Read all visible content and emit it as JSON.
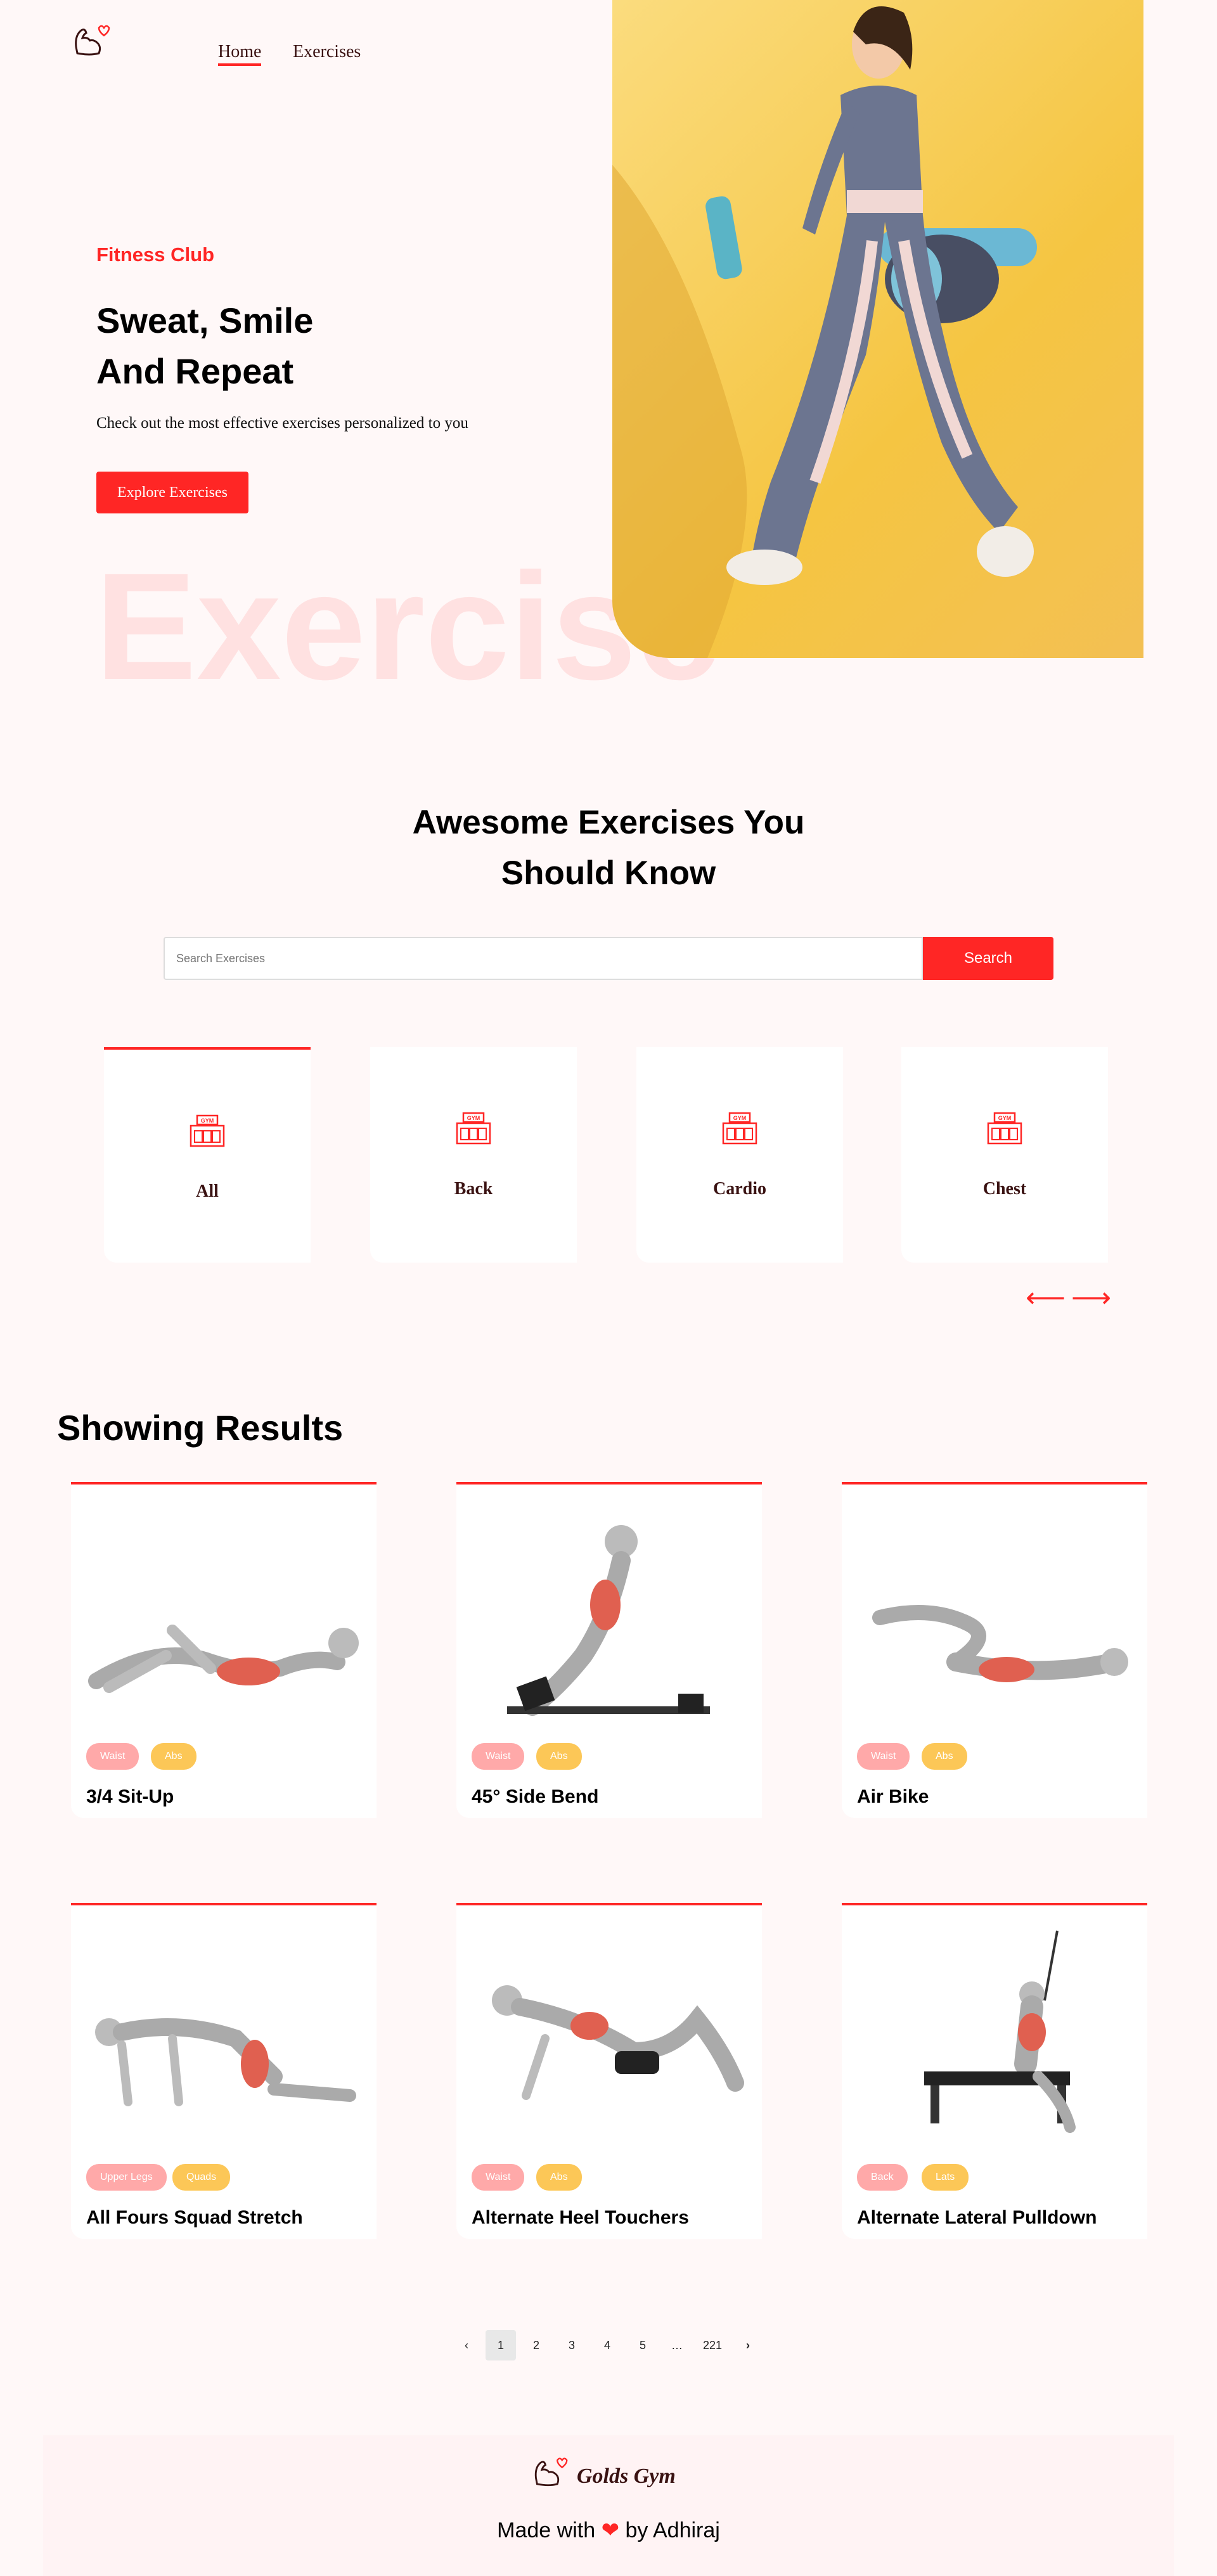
{
  "navbar": {
    "home": "Home",
    "exercises": "Exercises"
  },
  "hero": {
    "tag": "Fitness Club",
    "title_line1": "Sweat, Smile",
    "title_line2": "And Repeat",
    "description": "Check out the most effective exercises personalized to you",
    "button": "Explore Exercises",
    "bg_word": "Exercise"
  },
  "search": {
    "title_line1": "Awesome Exercises You",
    "title_line2": "Should Know",
    "placeholder": "Search Exercises",
    "button": "Search"
  },
  "body_parts": [
    {
      "label": "All",
      "icon": "gym-icon"
    },
    {
      "label": "Back",
      "icon": "gym-icon"
    },
    {
      "label": "Cardio",
      "icon": "gym-icon"
    },
    {
      "label": "Chest",
      "icon": "gym-icon"
    }
  ],
  "arrows": {
    "left": "⟵",
    "right": "⟶"
  },
  "results": {
    "title": "Showing Results",
    "exercises": [
      {
        "name": "3/4 Sit-Up",
        "tag1": "Waist",
        "tag2": "Abs"
      },
      {
        "name": "45° Side Bend",
        "tag1": "Waist",
        "tag2": "Abs"
      },
      {
        "name": "Air Bike",
        "tag1": "Waist",
        "tag2": "Abs"
      },
      {
        "name": "All Fours Squad Stretch",
        "tag1": "Upper Legs",
        "tag2": "Quads"
      },
      {
        "name": "Alternate Heel Touchers",
        "tag1": "Waist",
        "tag2": "Abs"
      },
      {
        "name": "Alternate Lateral Pulldown",
        "tag1": "Back",
        "tag2": "Lats"
      }
    ]
  },
  "pagination": {
    "prev": "‹",
    "pages": [
      "1",
      "2",
      "3",
      "4",
      "5",
      "…",
      "221"
    ],
    "next": "›",
    "current": "1"
  },
  "footer": {
    "brand": "Golds Gym",
    "made_with": "Made with",
    "by": "by Adhiraj",
    "heart": "❤"
  },
  "colors": {
    "accent": "#ff2625",
    "pill_pink": "#ffa9a9",
    "pill_yellow": "#fcc757",
    "hero_yellow": "#f5c542"
  }
}
